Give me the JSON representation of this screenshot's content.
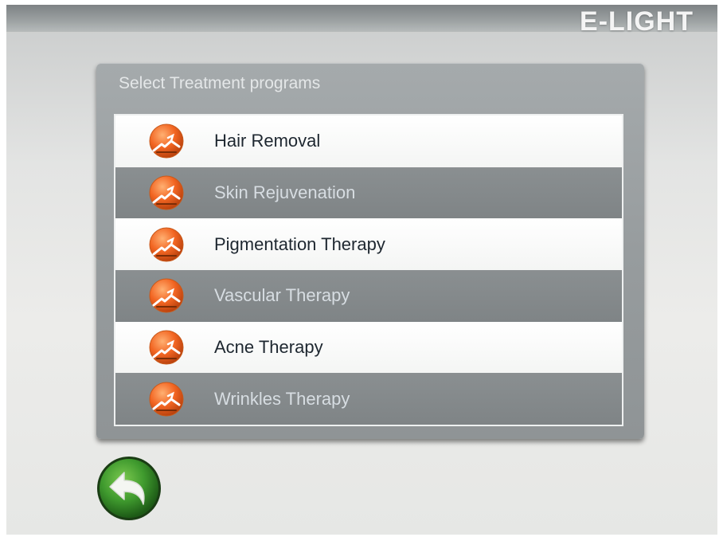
{
  "header": {
    "brand": "E-LIGHT"
  },
  "panel": {
    "title": "Select Treatment programs",
    "items": [
      {
        "label": "Hair Removal",
        "icon": "treatment-icon"
      },
      {
        "label": "Skin Rejuvenation",
        "icon": "treatment-icon"
      },
      {
        "label": "Pigmentation Therapy",
        "icon": "treatment-icon"
      },
      {
        "label": "Vascular Therapy",
        "icon": "treatment-icon"
      },
      {
        "label": "Acne Therapy",
        "icon": "treatment-icon"
      },
      {
        "label": "Wrinkles  Therapy",
        "icon": "treatment-icon"
      }
    ]
  },
  "footer": {
    "back_icon": "back-arrow-icon"
  },
  "colors": {
    "accent_orange": "#f26522",
    "back_green": "#3f9a2e",
    "row_dark": "#858a8c",
    "row_light": "#ffffff"
  }
}
